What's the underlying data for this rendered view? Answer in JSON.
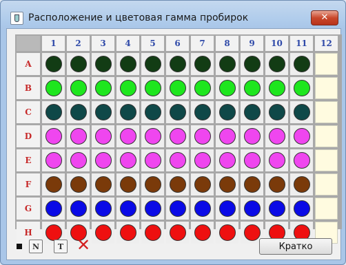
{
  "window": {
    "title": "Расположение и цветовая гамма пробирок",
    "close_label": "✕"
  },
  "grid": {
    "columns": [
      "1",
      "2",
      "3",
      "4",
      "5",
      "6",
      "7",
      "8",
      "9",
      "10",
      "11",
      "12"
    ],
    "rows": [
      {
        "label": "A",
        "color": "#123c14",
        "filled": 11
      },
      {
        "label": "B",
        "color": "#1ee61e",
        "filled": 11
      },
      {
        "label": "C",
        "color": "#0f4848",
        "filled": 11
      },
      {
        "label": "D",
        "color": "#ef46ef",
        "filled": 11
      },
      {
        "label": "E",
        "color": "#ef46ef",
        "filled": 11
      },
      {
        "label": "F",
        "color": "#7a3a0a",
        "filled": 11
      },
      {
        "label": "G",
        "color": "#0a0ae6",
        "filled": 11
      },
      {
        "label": "H",
        "color": "#ee1010",
        "filled": 11
      }
    ]
  },
  "footer": {
    "n_label": "N",
    "t_label": "T",
    "delete_label": "✕",
    "brief_label": "Кратко"
  }
}
